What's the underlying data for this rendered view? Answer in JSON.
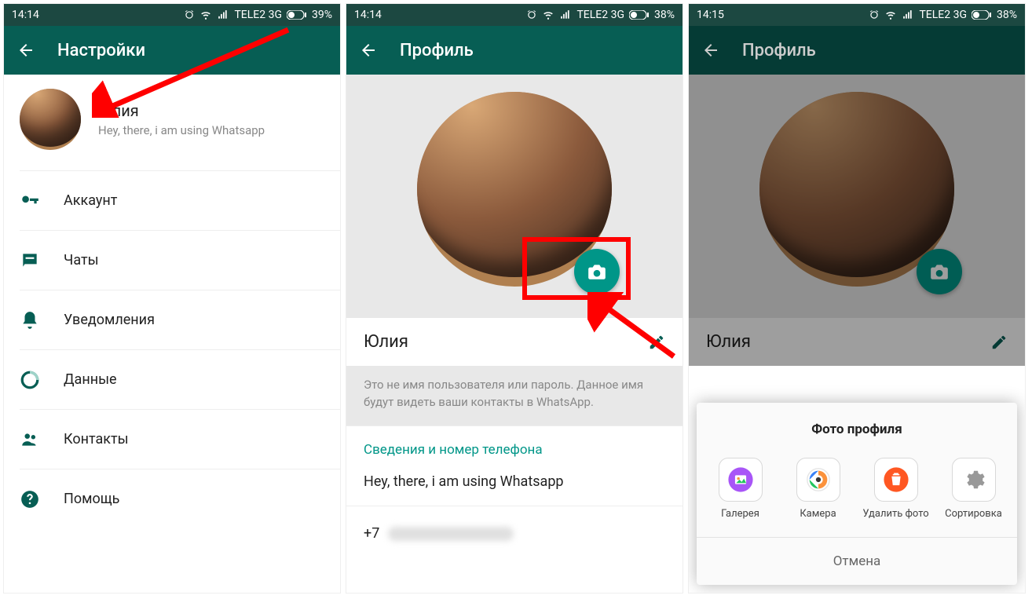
{
  "screen1": {
    "status": {
      "time": "14:14",
      "carrier": "TELE2 3G",
      "battery": "39%"
    },
    "title": "Настройки",
    "profile": {
      "name": "Юлия",
      "status": "Hey, there, i am using Whatsapp"
    },
    "menu": {
      "account": "Аккаунт",
      "chats": "Чаты",
      "notifications": "Уведомления",
      "data": "Данные",
      "contacts": "Контакты",
      "help": "Помощь"
    }
  },
  "screen2": {
    "status": {
      "time": "14:14",
      "carrier": "TELE2 3G",
      "battery": "38%"
    },
    "title": "Профиль",
    "name": "Юлия",
    "hint": "Это не имя пользователя или пароль. Данное имя будут видеть ваши контакты в WhatsApp.",
    "section": "Сведения и номер телефона",
    "status_text": "Hey, there, i am using Whatsapp",
    "phone_prefix": "+7"
  },
  "screen3": {
    "status": {
      "time": "14:15",
      "carrier": "TELE2 3G",
      "battery": "38%"
    },
    "title": "Профиль",
    "name": "Юлия",
    "dialog": {
      "title": "Фото профиля",
      "gallery": "Галерея",
      "camera": "Камера",
      "delete": "Удалить фото",
      "sort": "Сортировка",
      "cancel": "Отмена"
    }
  }
}
